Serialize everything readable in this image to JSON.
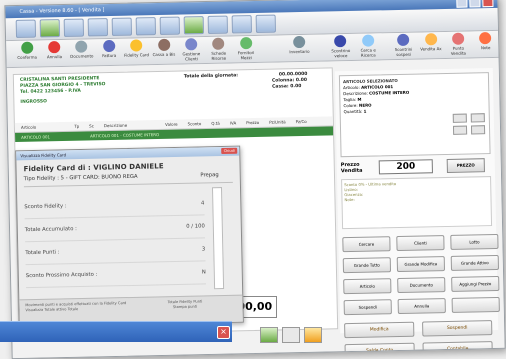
{
  "app": {
    "window_title": "Cassa - Versione 8.60 - [ Vendita ]"
  },
  "toolbar2": {
    "items": [
      "Conferma",
      "Annulla",
      "Documento",
      "Fattura",
      "Fidelity Card",
      "Cassa a Bis",
      "Gestione Clienti",
      "Schede Risorse",
      "Fornitori Mezzi",
      "Inventario",
      "Scontrino veloce",
      "Cerca e Ricerca",
      "Scontrini sospesi",
      "Vendita Ax",
      "Punto Vendita",
      "Note"
    ]
  },
  "sale": {
    "customer_lines": [
      "CRISTALINA SANTI PRESIDENTE",
      "PIAZZA SAN GIORGIO 4 - TREVISO",
      "Tel. 0422 123456 - P.IVA"
    ],
    "customer_label": "INGROSSO",
    "total_label": "Totale della giornata:",
    "total_value": "00.00.0000",
    "colonna_label": "Colonna:",
    "colonna_value": "0.00",
    "cassa_label": "Cassa:",
    "cassa_value": "0.00",
    "columns": [
      "Articolo",
      "Tp",
      "Sc",
      "Descrizione",
      "Valore",
      "Sconto",
      "Q.tà",
      "IVA",
      "Prezzo",
      "Pz/Unità",
      "Pz/Co"
    ],
    "row": [
      "ARTICOLO 001",
      "",
      "",
      "ARTICOLO 001 - COSTUME INTERO",
      "",
      "",
      "",
      "",
      "",
      "",
      ""
    ]
  },
  "article": {
    "title": "ARTICOLO SELEZIONATO",
    "rows": [
      {
        "label": "Articolo:",
        "value": "ARTICOLO 001"
      },
      {
        "label": "Descrizione:",
        "value": "COSTUME INTERO"
      },
      {
        "label": "Taglia:",
        "value": "M"
      },
      {
        "label": "Colore:",
        "value": "NERO"
      },
      {
        "label": "Quantità:",
        "value": "1"
      }
    ],
    "price_label": "Prezzo Vendita",
    "price_value": "200",
    "price_button": "PREZZO",
    "info_lines": [
      "Sconto 0% - Ultima vendita",
      "Listino:",
      "Giacenza:",
      "Note:"
    ]
  },
  "action_buttons": [
    "Cercare",
    "Clienti",
    "Lotto",
    "Grande Tutto",
    "Grande Modifica",
    "Grande Attivo",
    "Articolo",
    "Documento",
    "Aggiungi Prezzo",
    "Sospendi",
    "Annulla",
    ""
  ],
  "bottom_buttons": [
    "Modifica",
    "Salda Conto",
    "Sospendi",
    "Contabile"
  ],
  "total_display": "200,00",
  "fidelity": {
    "window_title": "Visualizza Fidelity Card",
    "close_label": "Chiudi",
    "heading": "Fidelity Card di : VIGLINO DANIELE",
    "type_line": "Tipo Fidelity : 5 - GIFT CARD: BUONO REGA",
    "right_note": "Prepag",
    "rows": [
      {
        "label": "Sconto Fidelity :",
        "value": "4"
      },
      {
        "label": "Totale Accumulato :",
        "value": "0 / 100"
      },
      {
        "label": "Totale Punti :",
        "value": "3"
      },
      {
        "label": "Sconto Prossimo Acquisto :",
        "value": "N"
      }
    ],
    "footer_left": "Movimenti punti e acquisti effettuati con la Fidelity Card",
    "footer_left2": "Visualizza     Totale attivo    Totale",
    "footer_right": "Totale Fidelity Punti",
    "footer_right2": "Stampa punti"
  },
  "colors": {
    "accent": "#3b8b3f",
    "title_bar": "#4a77b9",
    "close_red": "#d9534f"
  }
}
